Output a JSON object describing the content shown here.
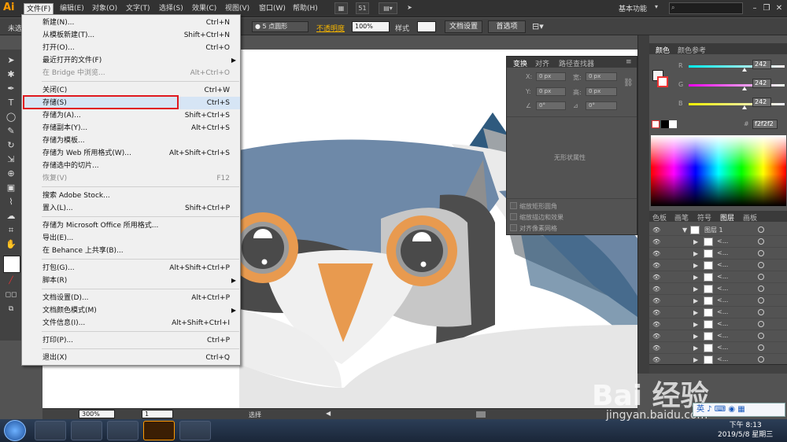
{
  "app": {
    "logo": "Ai"
  },
  "menubar": {
    "items": [
      "文件(F)",
      "编辑(E)",
      "对象(O)",
      "文字(T)",
      "选择(S)",
      "效果(C)",
      "视图(V)",
      "窗口(W)",
      "帮助(H)"
    ],
    "badge": "51",
    "workspace": "基本功能",
    "search_placeholder": ""
  },
  "controlbar": {
    "left_label": "未选",
    "stroke_style": "5 点圆形",
    "opacity_label": "不透明度",
    "opacity_value": "100%",
    "style_label": "样式",
    "doc_setup": "文档设置",
    "preferences": "首选项"
  },
  "file_menu": {
    "items": [
      {
        "label": "新建(N)...",
        "shortcut": "Ctrl+N",
        "disabled": false
      },
      {
        "label": "从模板新建(T)...",
        "shortcut": "Shift+Ctrl+N",
        "disabled": false
      },
      {
        "label": "打开(O)...",
        "shortcut": "Ctrl+O",
        "disabled": false
      },
      {
        "label": "最近打开的文件(F)",
        "shortcut": "",
        "disabled": false,
        "submenu": true
      },
      {
        "label": "在 Bridge 中浏览...",
        "shortcut": "Alt+Ctrl+O",
        "disabled": true
      },
      {
        "label": "关闭(C)",
        "shortcut": "Ctrl+W",
        "disabled": false
      },
      {
        "label": "存储(S)",
        "shortcut": "Ctrl+S",
        "disabled": false,
        "highlighted": true
      },
      {
        "label": "存储为(A)...",
        "shortcut": "Shift+Ctrl+S",
        "disabled": false
      },
      {
        "label": "存储副本(Y)...",
        "shortcut": "Alt+Ctrl+S",
        "disabled": false
      },
      {
        "label": "存储为模板...",
        "shortcut": "",
        "disabled": false
      },
      {
        "label": "存储为 Web 所用格式(W)...",
        "shortcut": "Alt+Shift+Ctrl+S",
        "disabled": false
      },
      {
        "label": "存储选中的切片...",
        "shortcut": "",
        "disabled": false
      },
      {
        "label": "恢复(V)",
        "shortcut": "F12",
        "disabled": true
      },
      {
        "label": "搜索 Adobe Stock...",
        "shortcut": "",
        "disabled": false
      },
      {
        "label": "置入(L)...",
        "shortcut": "Shift+Ctrl+P",
        "disabled": false
      },
      {
        "label": "存储为 Microsoft Office 所用格式...",
        "shortcut": "",
        "disabled": false
      },
      {
        "label": "导出(E)...",
        "shortcut": "",
        "disabled": false
      },
      {
        "label": "在 Behance 上共享(B)...",
        "shortcut": "",
        "disabled": false
      },
      {
        "label": "打包(G)...",
        "shortcut": "Alt+Shift+Ctrl+P",
        "disabled": false
      },
      {
        "label": "脚本(R)",
        "shortcut": "",
        "disabled": false,
        "submenu": true
      },
      {
        "label": "文档设置(D)...",
        "shortcut": "Alt+Ctrl+P",
        "disabled": false
      },
      {
        "label": "文档颜色模式(M)",
        "shortcut": "",
        "disabled": false,
        "submenu": true
      },
      {
        "label": "文件信息(I)...",
        "shortcut": "Alt+Shift+Ctrl+I",
        "disabled": false
      },
      {
        "label": "打印(P)...",
        "shortcut": "Ctrl+P",
        "disabled": false
      },
      {
        "label": "退出(X)",
        "shortcut": "Ctrl+Q",
        "disabled": false
      }
    ]
  },
  "transform_panel": {
    "tabs": [
      "变换",
      "对齐",
      "路径查找器"
    ],
    "x_label": "X:",
    "y_label": "Y:",
    "w_label": "宽:",
    "h_label": "高:",
    "x_value": "0 px",
    "y_value": "0 px",
    "w_value": "0 px",
    "h_value": "0 px",
    "angle1": "0°",
    "angle2": "0°",
    "no_shape": "无形状属性",
    "options": [
      "缩放矩形圆角",
      "缩放描边和效果",
      "对齐像素网格"
    ]
  },
  "color_panel": {
    "tabs": [
      "颜色",
      "颜色参考"
    ],
    "r_label": "R",
    "g_label": "G",
    "b_label": "B",
    "r": "242",
    "g": "242",
    "b": "242",
    "hex": "f2f2f2"
  },
  "layers_panel": {
    "tabs": [
      "色板",
      "画笔",
      "符号",
      "图层",
      "画板"
    ],
    "top_layer": "图层 1",
    "sublayer_label": "<...",
    "sublayer_count": 11
  },
  "statusbar": {
    "zoom": "300%",
    "page": "1",
    "tool": "选择"
  },
  "taskbar": {
    "time": "下午 8:13",
    "date": "2019/5/8 星期三",
    "ime": "英"
  },
  "watermark": {
    "brand": "Bai 经验",
    "url": "jingyan.baidu.com"
  }
}
